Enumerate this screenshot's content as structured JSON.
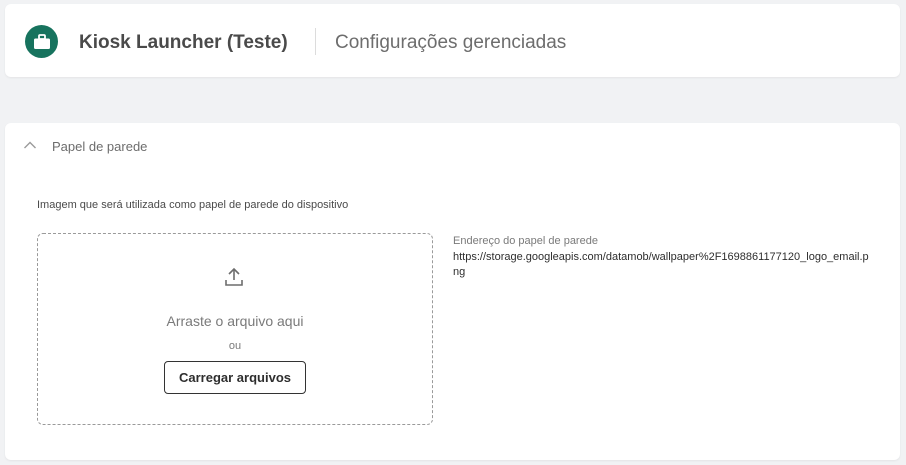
{
  "header": {
    "app_icon": "briefcase-icon",
    "app_title": "Kiosk Launcher (Teste)",
    "page_subtitle": "Configurações gerenciadas"
  },
  "section": {
    "chevron_icon": "chevron-up-icon",
    "title": "Papel de parede",
    "description": "Imagem que será utilizada como papel de parede do dispositivo",
    "dropzone": {
      "icon": "upload-icon",
      "drag_text": "Arraste o arquivo aqui",
      "or_text": "ou",
      "button_label": "Carregar arquivos"
    },
    "url_label": "Endereço do papel de parede",
    "url_value": "https://storage.googleapis.com/datamob/wallpaper%2F1698861177120_logo_email.png"
  },
  "colors": {
    "accent": "#17735e",
    "background": "#f1f2f4"
  }
}
